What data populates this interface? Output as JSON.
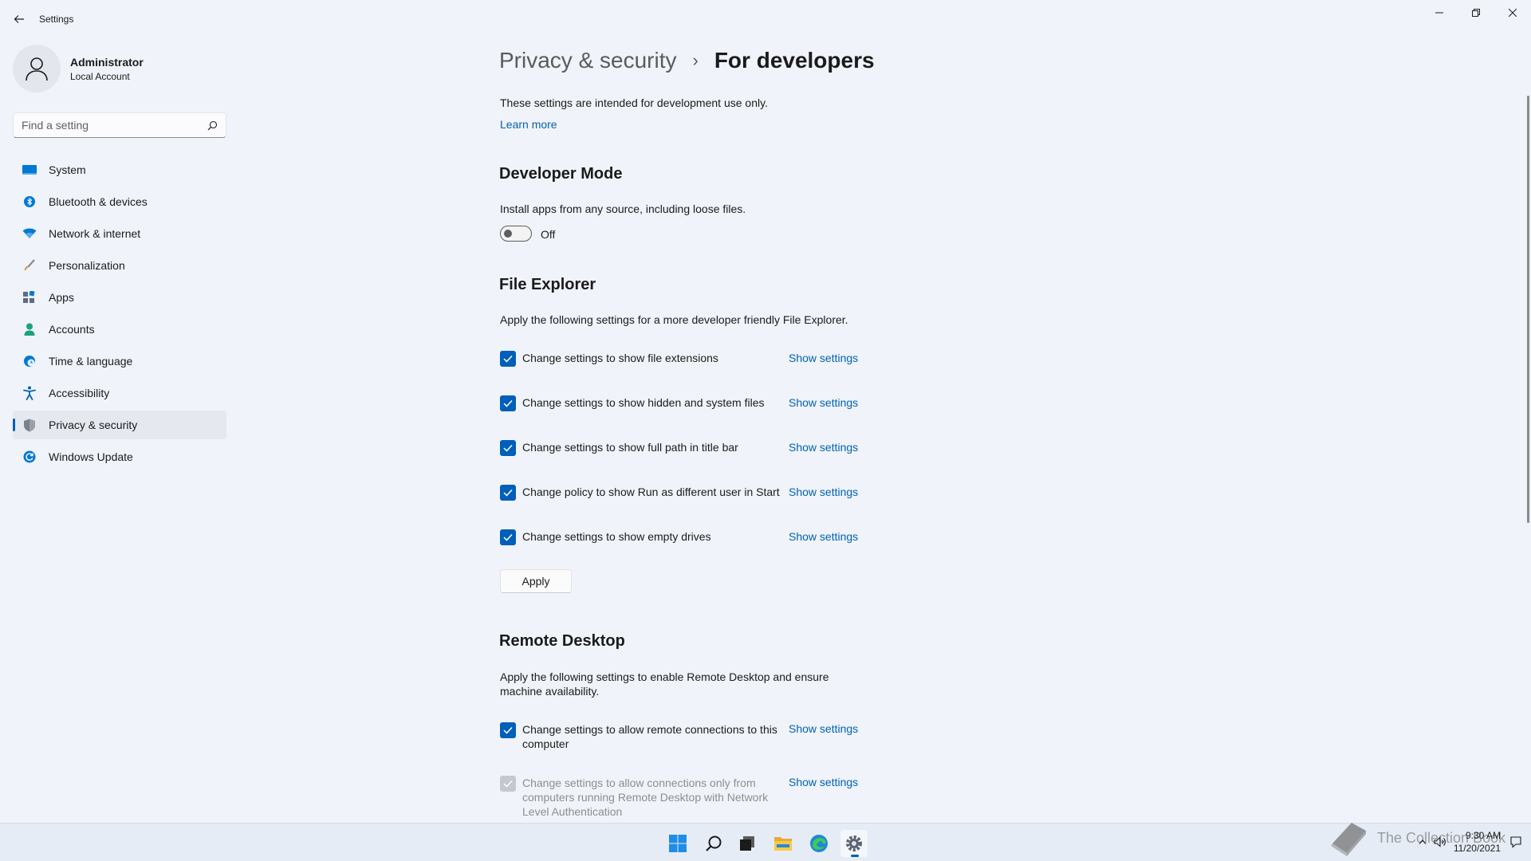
{
  "window": {
    "title": "Settings",
    "controls": [
      "minimize-icon",
      "restore-icon",
      "close-icon"
    ]
  },
  "user": {
    "name": "Administrator",
    "account_type": "Local Account"
  },
  "search": {
    "placeholder": "Find a setting"
  },
  "nav": {
    "items": [
      {
        "label": "System",
        "icon": "monitor-icon",
        "color": "#0078d4"
      },
      {
        "label": "Bluetooth & devices",
        "icon": "bluetooth-icon",
        "color": "#0078d4"
      },
      {
        "label": "Network & internet",
        "icon": "wifi-icon",
        "color": "#0078d4"
      },
      {
        "label": "Personalization",
        "icon": "brush-icon",
        "color": "#c86a1e"
      },
      {
        "label": "Apps",
        "icon": "apps-icon",
        "color": "#5b6b8c"
      },
      {
        "label": "Accounts",
        "icon": "person-icon",
        "color": "#1aa37a"
      },
      {
        "label": "Time & language",
        "icon": "globe-clock-icon",
        "color": "#0078d4"
      },
      {
        "label": "Accessibility",
        "icon": "accessibility-icon",
        "color": "#0063b1"
      },
      {
        "label": "Privacy & security",
        "icon": "shield-icon",
        "color": "#6b7280",
        "active": true
      },
      {
        "label": "Windows Update",
        "icon": "update-icon",
        "color": "#0078d4"
      }
    ]
  },
  "header": {
    "parent": "Privacy & security",
    "separator": "›",
    "current": "For developers"
  },
  "intro": {
    "text": "These settings are intended for development use only.",
    "learn_more": "Learn more"
  },
  "developer_mode": {
    "title": "Developer Mode",
    "description": "Install apps from any source, including loose files.",
    "toggle_state": "Off",
    "enabled": false
  },
  "file_explorer": {
    "title": "File Explorer",
    "description": "Apply the following settings for a more developer friendly File Explorer.",
    "options": [
      {
        "label": "Change settings to show file extensions",
        "checked": true,
        "link": "Show settings"
      },
      {
        "label": "Change settings to show hidden and system files",
        "checked": true,
        "link": "Show settings"
      },
      {
        "label": "Change settings to show full path in title bar",
        "checked": true,
        "link": "Show settings"
      },
      {
        "label": "Change policy to show Run as different user in Start",
        "checked": true,
        "link": "Show settings"
      },
      {
        "label": "Change settings to show empty drives",
        "checked": true,
        "link": "Show settings"
      }
    ],
    "apply_label": "Apply"
  },
  "remote_desktop": {
    "title": "Remote Desktop",
    "description": "Apply the following settings to enable Remote Desktop and ensure machine availability.",
    "options": [
      {
        "label": "Change settings to allow remote connections to this computer",
        "checked": true,
        "disabled": false,
        "link": "Show settings"
      },
      {
        "label": "Change settings to allow connections only from computers running Remote Desktop with Network Level Authentication",
        "checked": true,
        "disabled": true,
        "link": "Show settings"
      }
    ]
  },
  "taskbar": {
    "apps": [
      "windows-start-icon",
      "search-icon",
      "task-view-icon",
      "file-explorer-icon",
      "edge-icon",
      "settings-icon"
    ],
    "active_app": "settings-icon",
    "watermark": "The Collection Book",
    "time": "9:30 AM",
    "date": "11/20/2021",
    "tray": [
      "chevron-up-icon",
      "speaker-icon",
      "notification-icon"
    ]
  },
  "colors": {
    "accent": "#005fb8",
    "link": "#0063b1",
    "background": "#f0f3f9"
  }
}
